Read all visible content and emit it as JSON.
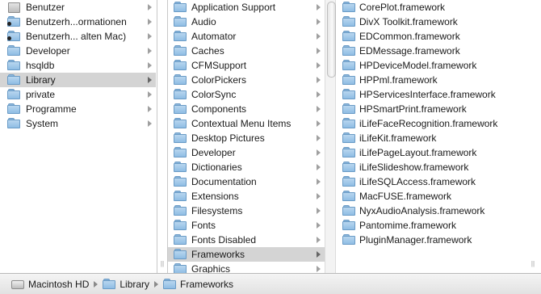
{
  "columns": {
    "col1": {
      "items": [
        {
          "label": "Benutzer",
          "icon": "home-folder-icon"
        },
        {
          "label": "Benutzerh...ormationen",
          "icon": "user-folder-icon"
        },
        {
          "label": "Benutzerh... alten Mac)",
          "icon": "user-folder-icon"
        },
        {
          "label": "Developer",
          "icon": "folder-icon"
        },
        {
          "label": "hsqldb",
          "icon": "folder-icon"
        },
        {
          "label": "Library",
          "icon": "folder-icon",
          "selected": true
        },
        {
          "label": "private",
          "icon": "folder-icon"
        },
        {
          "label": "Programme",
          "icon": "folder-icon"
        },
        {
          "label": "System",
          "icon": "folder-icon"
        }
      ]
    },
    "col2": {
      "items": [
        {
          "label": "Application Support"
        },
        {
          "label": "Audio"
        },
        {
          "label": "Automator"
        },
        {
          "label": "Caches"
        },
        {
          "label": "CFMSupport"
        },
        {
          "label": "ColorPickers"
        },
        {
          "label": "ColorSync"
        },
        {
          "label": "Components"
        },
        {
          "label": "Contextual Menu Items"
        },
        {
          "label": "Desktop Pictures"
        },
        {
          "label": "Developer"
        },
        {
          "label": "Dictionaries"
        },
        {
          "label": "Documentation"
        },
        {
          "label": "Extensions"
        },
        {
          "label": "Filesystems"
        },
        {
          "label": "Fonts"
        },
        {
          "label": "Fonts Disabled"
        },
        {
          "label": "Frameworks",
          "selected": true
        },
        {
          "label": "Graphics"
        }
      ]
    },
    "col3": {
      "items": [
        {
          "label": "CorePlot.framework"
        },
        {
          "label": "DivX Toolkit.framework"
        },
        {
          "label": "EDCommon.framework"
        },
        {
          "label": "EDMessage.framework"
        },
        {
          "label": "HPDeviceModel.framework"
        },
        {
          "label": "HPPml.framework"
        },
        {
          "label": "HPServicesInterface.framework"
        },
        {
          "label": "HPSmartPrint.framework"
        },
        {
          "label": "iLifeFaceRecognition.framework"
        },
        {
          "label": "iLifeKit.framework"
        },
        {
          "label": "iLifePageLayout.framework"
        },
        {
          "label": "iLifeSlideshow.framework"
        },
        {
          "label": "iLifeSQLAccess.framework"
        },
        {
          "label": "MacFUSE.framework"
        },
        {
          "label": "NyxAudioAnalysis.framework"
        },
        {
          "label": "Pantomime.framework"
        },
        {
          "label": "PluginManager.framework"
        }
      ]
    }
  },
  "pathbar": {
    "segments": [
      {
        "label": "Macintosh HD",
        "icon": "hard-disk-icon"
      },
      {
        "label": "Library",
        "icon": "folder-icon"
      },
      {
        "label": "Frameworks",
        "icon": "folder-icon"
      }
    ]
  },
  "colors": {
    "selection": "#d4d4d4",
    "folder_blue": "#8fbde4"
  }
}
